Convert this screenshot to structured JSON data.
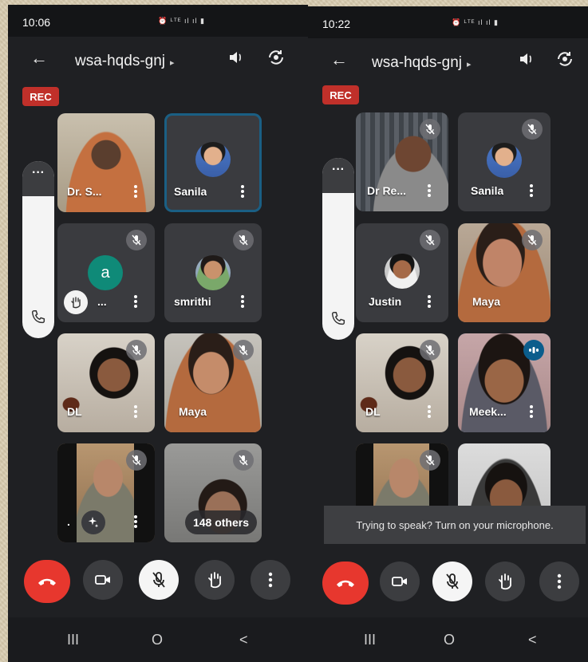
{
  "left": {
    "status": {
      "time": "10:06",
      "icons": "⏰ ᴸᵀᴱ ıl ıl ▮"
    },
    "meeting_code": "wsa-hqds-gnj",
    "rec": "REC",
    "more_dots": "···",
    "tiles": [
      {
        "name": "Dr. S...",
        "muted": false
      },
      {
        "name": "Sanila",
        "muted": false
      },
      {
        "name": "...",
        "avatar_letter": "a",
        "muted": true,
        "hand_raised": true
      },
      {
        "name": "smrithi",
        "muted": true
      },
      {
        "name": "DL",
        "muted": true
      },
      {
        "name": "Maya",
        "muted": true
      },
      {
        "name": ".",
        "muted": true
      },
      {
        "name": "",
        "muted": true,
        "others": "148 others"
      }
    ]
  },
  "right": {
    "status": {
      "time": "10:22",
      "icons": "⏰ ᴸᵀᴱ ıl ıl ▮"
    },
    "meeting_code": "wsa-hqds-gnj",
    "rec": "REC",
    "more_dots": "···",
    "tiles": [
      {
        "name": "Dr Re...",
        "muted": true
      },
      {
        "name": "Sanila",
        "muted": true
      },
      {
        "name": "Justin",
        "muted": true
      },
      {
        "name": "Maya",
        "muted": true
      },
      {
        "name": "DL",
        "muted": true
      },
      {
        "name": "Meek...",
        "speaking": true
      },
      {
        "name": "",
        "muted": true
      },
      {
        "name": ""
      }
    ],
    "toast": "Trying to speak? Turn on your microphone."
  },
  "icons": {
    "back": "back-arrow-icon",
    "speaker": "speaker-icon",
    "camera_switch": "camera-switch-icon",
    "mic_off": "mic-off-icon",
    "hangup": "hangup-icon",
    "video": "video-icon",
    "hand": "raise-hand-icon",
    "more": "more-vert-icon",
    "phone": "phone-icon"
  },
  "colors": {
    "background": "#1f2023",
    "rec": "#c0302a",
    "hangup": "#e7372e",
    "speaking": "#0b5d8c",
    "avatar": "#0f8a78"
  },
  "nav": {
    "recents": "III",
    "home": "O",
    "back": "<"
  }
}
